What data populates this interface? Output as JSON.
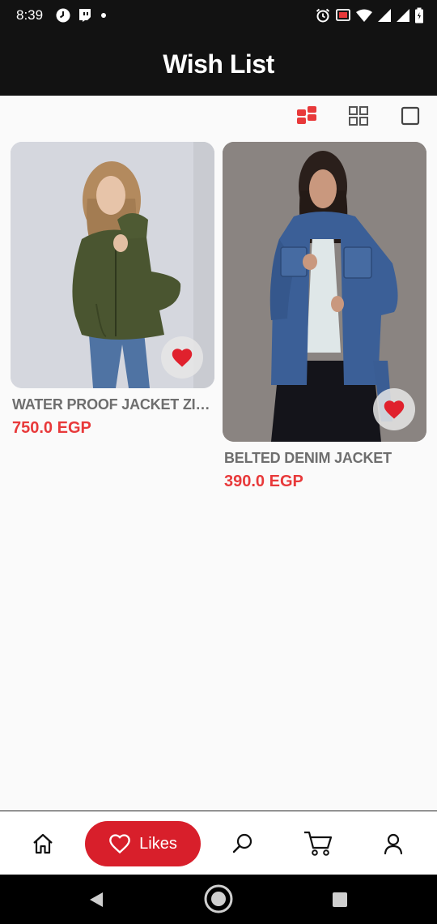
{
  "status_bar": {
    "time": "8:39",
    "left_icons": [
      "clock-icon",
      "twitch-icon",
      "dot-icon"
    ],
    "right_icons": [
      "alarm-icon",
      "cast-icon",
      "wifi-icon",
      "signal-icon",
      "signal-icon",
      "battery-icon"
    ]
  },
  "header": {
    "title": "Wish List"
  },
  "view_toggle": {
    "options": [
      "staggered-grid-icon",
      "grid-icon",
      "single-view-icon"
    ],
    "active": "staggered-grid-icon",
    "active_color": "#e8393a"
  },
  "products": [
    {
      "name": "WATER PROOF JACKET ZIPPER...",
      "price": "750.0 EGP",
      "liked": true
    },
    {
      "name": "BELTED DENIM JACKET",
      "price": "390.0 EGP",
      "liked": true
    }
  ],
  "bottom_nav": {
    "items": [
      {
        "icon": "home-icon",
        "label": ""
      },
      {
        "icon": "heart-icon",
        "label": "Likes",
        "active": true
      },
      {
        "icon": "search-icon",
        "label": ""
      },
      {
        "icon": "cart-icon",
        "label": ""
      },
      {
        "icon": "user-icon",
        "label": ""
      }
    ],
    "active_color": "#d81f2b"
  },
  "system_nav": [
    "back-icon",
    "home-circle-icon",
    "recents-icon"
  ]
}
